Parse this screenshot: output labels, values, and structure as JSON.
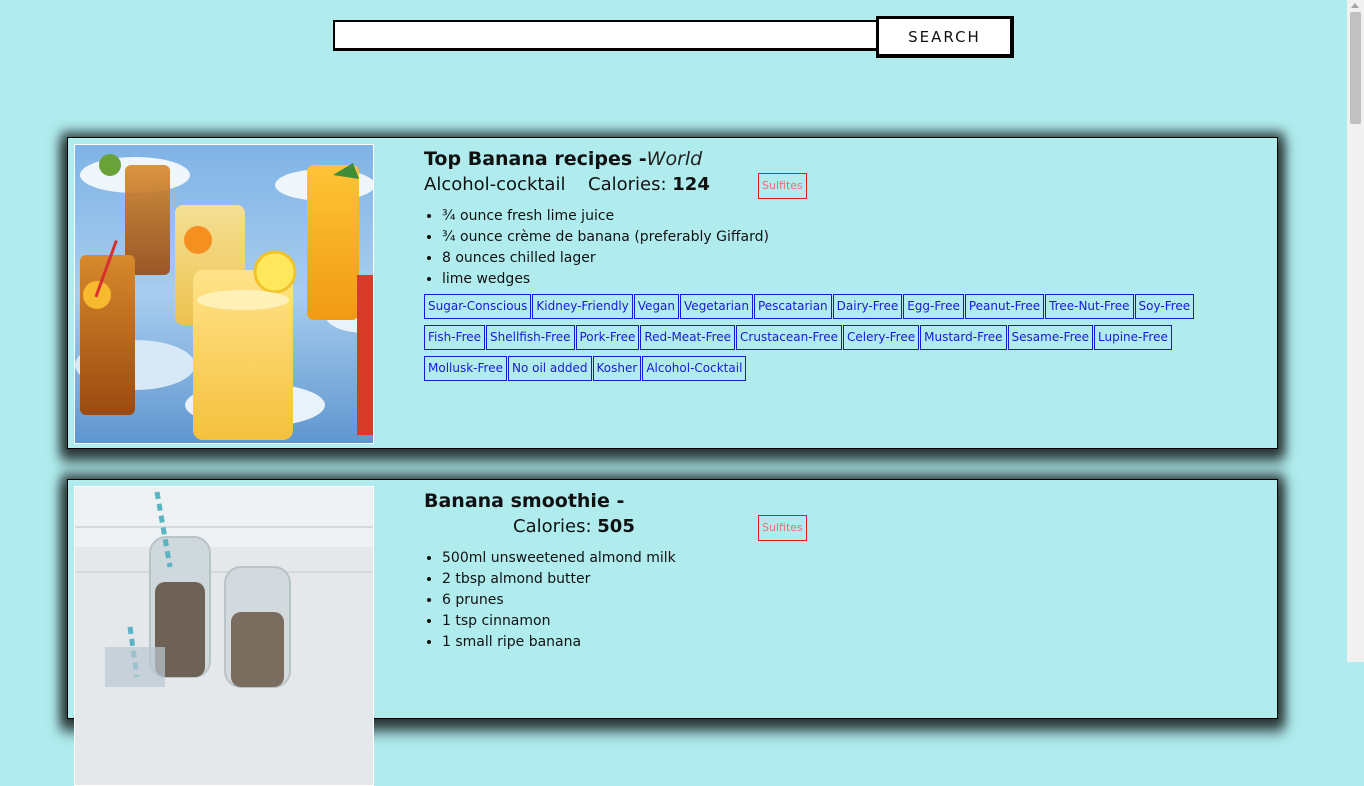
{
  "search": {
    "placeholder": "",
    "value": "",
    "button_label": "SEARCH"
  },
  "recipes": [
    {
      "title": "Top Banana recipes -",
      "source": "World",
      "dish_type": "Alcohol-cocktail",
      "calories_label": "Calories:",
      "calories": "124",
      "cautions": [
        "Sulfites"
      ],
      "ingredients": [
        "¾ ounce fresh lime juice",
        "¾ ounce crème de banana (preferably Giffard)",
        "8 ounces chilled lager",
        "lime wedges"
      ],
      "health_labels": [
        "Sugar-Conscious",
        "Kidney-Friendly",
        "Vegan",
        "Vegetarian",
        "Pescatarian",
        "Dairy-Free",
        "Egg-Free",
        "Peanut-Free",
        "Tree-Nut-Free",
        "Soy-Free",
        "Fish-Free",
        "Shellfish-Free",
        "Pork-Free",
        "Red-Meat-Free",
        "Crustacean-Free",
        "Celery-Free",
        "Mustard-Free",
        "Sesame-Free",
        "Lupine-Free",
        "Mollusk-Free",
        "No oil added",
        "Kosher",
        "Alcohol-Cocktail"
      ]
    },
    {
      "title": "Banana smoothie -",
      "source": "",
      "dish_type": "",
      "calories_label": "Calories:",
      "calories": "505",
      "cautions": [
        "Sulfites"
      ],
      "ingredients": [
        "500ml unsweetened almond milk",
        "2 tbsp almond butter",
        "6 prunes",
        "1 tsp cinnamon",
        "1 small ripe banana"
      ],
      "health_labels": []
    }
  ]
}
